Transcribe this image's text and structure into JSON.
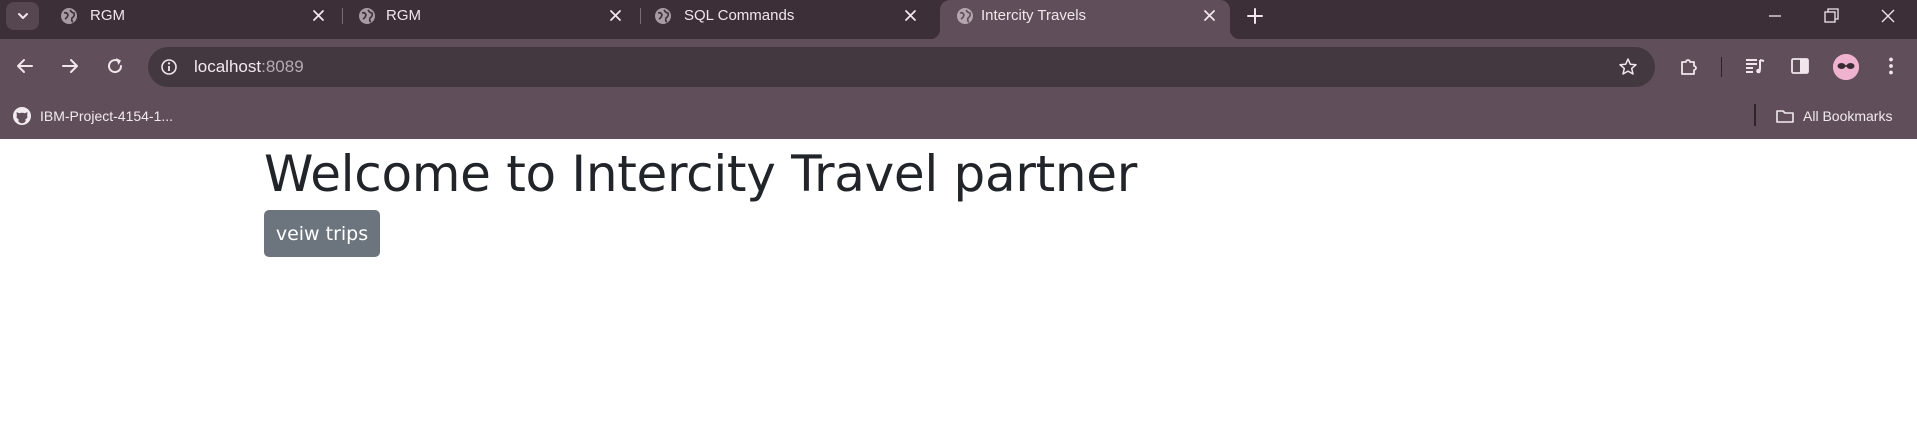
{
  "tabs": [
    {
      "label": "RGM",
      "active": false
    },
    {
      "label": "RGM",
      "active": false
    },
    {
      "label": "SQL Commands",
      "active": false
    },
    {
      "label": "Intercity Travels",
      "active": true
    }
  ],
  "omnibox": {
    "host": "localhost",
    "port": ":8089"
  },
  "bookmarks": {
    "item_label": "IBM-Project-4154-1...",
    "all_label": "All Bookmarks"
  },
  "page": {
    "heading": "Welcome to Intercity Travel partner",
    "button_label": "veiw trips"
  },
  "colors": {
    "tabstrip": "#3d2f37",
    "toolbar": "#604f5a",
    "omnibox": "#433740",
    "button": "#6c757d",
    "heading": "#212529"
  },
  "icons": [
    "tab-search-icon",
    "globe-icon",
    "close-icon",
    "plus-icon",
    "minimize-icon",
    "restore-icon",
    "window-close-icon",
    "back-arrow-icon",
    "forward-arrow-icon",
    "reload-icon",
    "info-icon",
    "star-icon",
    "extensions-icon",
    "media-controls-icon",
    "side-panel-icon",
    "profile-avatar",
    "kebab-menu-icon",
    "github-icon",
    "folder-icon"
  ]
}
